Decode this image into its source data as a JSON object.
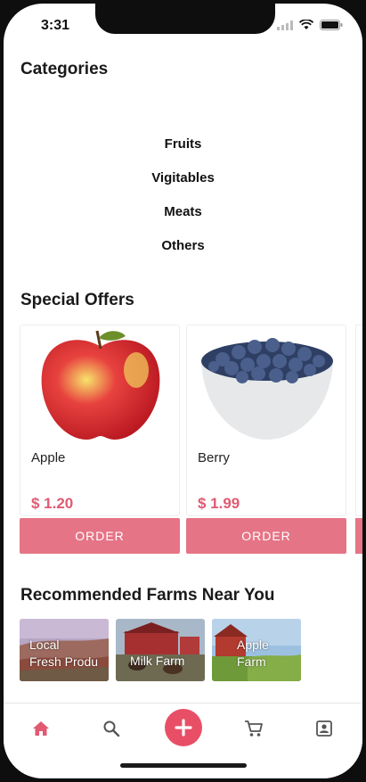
{
  "status_bar": {
    "time": "3:31"
  },
  "categories": {
    "title": "Categories",
    "items": [
      "Fruits",
      "Vigitables",
      "Meats",
      "Others"
    ]
  },
  "special_offers": {
    "title": "Special Offers",
    "items": [
      {
        "name": "Apple",
        "price": "$ 1.20",
        "button": "ORDER",
        "image": "apple"
      },
      {
        "name": "Berry",
        "price": "$ 1.99",
        "button": "ORDER",
        "image": "blueberry-bowl"
      }
    ]
  },
  "farms": {
    "title": "Recommended Farms Near You",
    "items": [
      {
        "line1": "Local",
        "line2": "Fresh Produ"
      },
      {
        "line1": "Milk Farm",
        "line2": ""
      },
      {
        "line1": "Apple",
        "line2": "Farm"
      }
    ]
  },
  "tabbar": {
    "icons": [
      "home-icon",
      "search-icon",
      "add-icon",
      "cart-icon",
      "contact-icon"
    ],
    "active_color": "#e05a72",
    "inactive_color": "#555555"
  },
  "colors": {
    "accent": "#e57486",
    "price": "#e05a72",
    "fab": "#e84f67"
  }
}
